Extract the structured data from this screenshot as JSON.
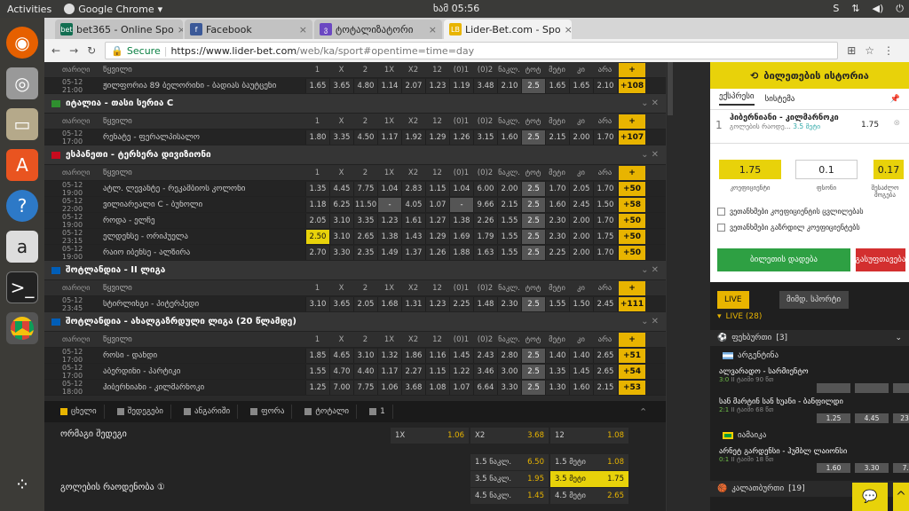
{
  "os": {
    "activities": "Activities",
    "app": "Google Chrome",
    "clock": "ხამ 05:56"
  },
  "tabs": [
    {
      "title": "bet365 - Online Spo",
      "color": "#126e51",
      "icon": "bet"
    },
    {
      "title": "Facebook",
      "color": "#3b5998",
      "icon": "f"
    },
    {
      "title": "ტოტალიზატორი",
      "color": "#6b47c2",
      "icon": "ვ"
    },
    {
      "title": "Lider-Bet.com - Spo",
      "color": "#e8b400",
      "icon": "LB"
    }
  ],
  "omnibox": {
    "secure": "Secure",
    "url_domain": "https://www.lider-bet.com",
    "url_path": "/web/ka/sport#opentime=time=day"
  },
  "odds_headers": [
    "1",
    "X",
    "2",
    "1X",
    "X2",
    "12",
    "(0)1",
    "(0)2",
    "ნაკლ.",
    "ტოტ",
    "მეტი",
    "კი",
    "არა"
  ],
  "col_head": {
    "a": "თარიღი",
    "b": "წყვილი"
  },
  "sections": [
    {
      "league": "",
      "flag_color": "",
      "events": [
        {
          "time": "05-12 21:00",
          "teams": "ჟილფორია 89 ბელორინი - ბადიას ბაუტცენი",
          "odds": [
            "1.65",
            "3.65",
            "4.80",
            "1.14",
            "2.07",
            "1.23",
            "1.19",
            "3.48",
            "2.10",
            "2.5",
            "1.65",
            "1.65",
            "2.10"
          ],
          "plus": "+108",
          "hl": -1
        }
      ]
    },
    {
      "league": "იტალია - თასი სერია C",
      "flag_color": "#2f8f2f",
      "events": [
        {
          "time": "05-12 17:00",
          "teams": "რენატე - ფერალპისალო",
          "odds": [
            "1.80",
            "3.35",
            "4.50",
            "1.17",
            "1.92",
            "1.29",
            "1.26",
            "3.15",
            "1.60",
            "2.5",
            "2.15",
            "2.00",
            "1.70"
          ],
          "plus": "+107",
          "hl": -1
        }
      ]
    },
    {
      "league": "ესპანეთი - ტერსერა დივიზიონი",
      "flag_color": "#c60b1e",
      "events": [
        {
          "time": "05-12 19:00",
          "teams": "ატლ. ლევანტე - რეკამბიოს კოლონი",
          "odds": [
            "1.35",
            "4.45",
            "7.75",
            "1.04",
            "2.83",
            "1.15",
            "1.04",
            "6.00",
            "2.00",
            "2.5",
            "1.70",
            "2.05",
            "1.70"
          ],
          "plus": "+50",
          "hl": -1
        },
        {
          "time": "05-12 22:00",
          "teams": "ვილიარეალი C - ბუნოლი",
          "odds": [
            "1.18",
            "6.25",
            "11.50",
            "-",
            "4.05",
            "1.07",
            "-",
            "9.66",
            "2.15",
            "2.5",
            "1.60",
            "2.45",
            "1.50"
          ],
          "plus": "+58",
          "hl": -1
        },
        {
          "time": "05-12 19:00",
          "teams": "როდა - ელჩე",
          "odds": [
            "2.05",
            "3.10",
            "3.35",
            "1.23",
            "1.61",
            "1.27",
            "1.38",
            "2.26",
            "1.55",
            "2.5",
            "2.30",
            "2.00",
            "1.70"
          ],
          "plus": "+50",
          "hl": -1
        },
        {
          "time": "05-12 23:15",
          "teams": "ელდენსე - ორიჰუელა",
          "odds": [
            "2.50",
            "3.10",
            "2.65",
            "1.38",
            "1.43",
            "1.29",
            "1.69",
            "1.79",
            "1.55",
            "2.5",
            "2.30",
            "2.00",
            "1.75"
          ],
          "plus": "+50",
          "hl": 0
        },
        {
          "time": "05-12 19:00",
          "teams": "რაიო იბენსე - ალზირა",
          "odds": [
            "2.70",
            "3.30",
            "2.35",
            "1.49",
            "1.37",
            "1.26",
            "1.88",
            "1.63",
            "1.55",
            "2.5",
            "2.25",
            "2.00",
            "1.70"
          ],
          "plus": "+50",
          "hl": -1
        }
      ]
    },
    {
      "league": "შოტლანდია - II ლიგა",
      "flag_color": "#005eb8",
      "events": [
        {
          "time": "05-12 23:45",
          "teams": "სტირლინგი - პიტერჰედი",
          "odds": [
            "3.10",
            "3.65",
            "2.05",
            "1.68",
            "1.31",
            "1.23",
            "2.25",
            "1.48",
            "2.30",
            "2.5",
            "1.55",
            "1.50",
            "2.45"
          ],
          "plus": "+111",
          "hl": -1
        }
      ]
    },
    {
      "league": "შოტლანდია - ახალგაზრდული ლიგა (20 წლამდე)",
      "flag_color": "#005eb8",
      "events": [
        {
          "time": "05-12 17:00",
          "teams": "როსი - დანდი",
          "odds": [
            "1.85",
            "4.65",
            "3.10",
            "1.32",
            "1.86",
            "1.16",
            "1.45",
            "2.43",
            "2.80",
            "2.5",
            "1.40",
            "1.40",
            "2.65"
          ],
          "plus": "+51",
          "hl": -1
        },
        {
          "time": "05-12 17:00",
          "teams": "აბერდინი - პარტიკი",
          "odds": [
            "1.55",
            "4.70",
            "4.40",
            "1.17",
            "2.27",
            "1.15",
            "1.22",
            "3.46",
            "3.00",
            "2.5",
            "1.35",
            "1.45",
            "2.65"
          ],
          "plus": "+54",
          "hl": -1
        },
        {
          "time": "05-12 18:00",
          "teams": "ჰიბერნიანი - კილმარნოკი",
          "odds": [
            "1.25",
            "7.00",
            "7.75",
            "1.06",
            "3.68",
            "1.08",
            "1.07",
            "6.64",
            "3.30",
            "2.5",
            "1.30",
            "1.60",
            "2.15"
          ],
          "plus": "+53",
          "hl": -1
        }
      ]
    }
  ],
  "bottom_tabs": [
    "ცხელი",
    "შედეგები",
    "ანგარიში",
    "ფორა",
    "ტოტალი"
  ],
  "bottom_count": "1",
  "market1": {
    "title": "ორმაგი შედეგი",
    "items": [
      {
        "l": "1X",
        "v": "1.06"
      },
      {
        "l": "X2",
        "v": "3.68"
      },
      {
        "l": "12",
        "v": "1.08"
      }
    ]
  },
  "market2": {
    "title": "გოლების რაოდენობა ①",
    "items": [
      {
        "l": "1.5 ნაკლ.",
        "v": "6.50"
      },
      {
        "l": "1.5 მეტი",
        "v": "1.08"
      },
      {
        "l": "3.5 ნაკლ.",
        "v": "1.95"
      },
      {
        "l": "3.5 მეტი",
        "v": "1.75"
      },
      {
        "l": "4.5 ნაკლ.",
        "v": "1.45"
      },
      {
        "l": "4.5 მეტი",
        "v": "2.65"
      }
    ]
  },
  "betslip": {
    "history": "ბილეთების ისტორია",
    "tab1": "ექსპრესი",
    "tab2": "სისტემა",
    "num": "1",
    "match": "ჰიბერნიანი - კილმარნოკი",
    "desc": "გოლების რაოდე...",
    "pick": "3.5 მეტი",
    "odd": "1.75",
    "coef": "1.75",
    "stake": "0.1",
    "win": "0.17",
    "coef_l": "კოეფიციენტი",
    "stake_l": "ფსონი",
    "win_l": "შესაძლო მოგება",
    "chk1": "ვეთანხმები კოეფიციენტის ცვლილებას",
    "chk2": "ვეთანხმები გაზრდილ კოეფიციენტებს",
    "place": "ბილეთის დადება",
    "clear": "გასუფთავება"
  },
  "live": {
    "tab1": "LIVE",
    "tab2": "მიმდ. სპორტი",
    "header": "LIVE (28)",
    "sport": "ფეხბურთი",
    "sport_count": "[3]",
    "country1": "არგენტინა",
    "m1": {
      "name": "ალვარადო - სარმიენტო",
      "score": "3:0",
      "time": "II ტაიმი 90 წთ",
      "odds": [
        "",
        "",
        ""
      ]
    },
    "m2": {
      "name": "სან მარტინ სან ხუანი - ბანფილდი",
      "score": "2:1",
      "time": "II ტაიმი 68 წთ",
      "odds": [
        "1.25",
        "4.45",
        "23.00"
      ]
    },
    "country2": "იამაიკა",
    "m3": {
      "name": "არნეტ გარდენსი - ჰუმბლ ლაიონსი",
      "score": "0:1",
      "time": "II ტაიმი 18 წთ",
      "odds": [
        "1.60",
        "3.30",
        "7.25"
      ]
    },
    "sport2": "კალათბურთი",
    "sport2_count": "[19]"
  }
}
